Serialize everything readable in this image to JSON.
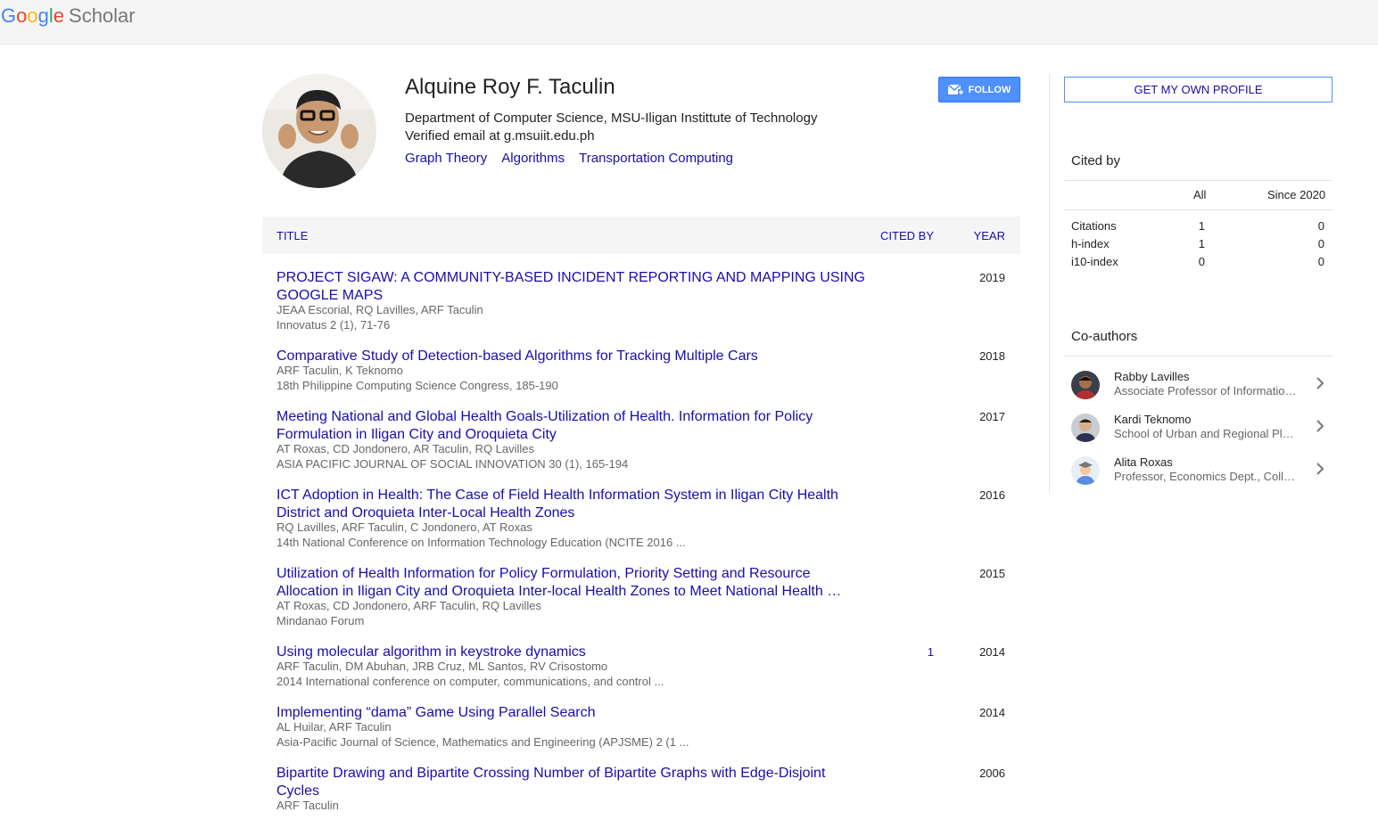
{
  "header": {
    "logo_g1": "G",
    "logo_o1": "o",
    "logo_o2": "o",
    "logo_g2": "g",
    "logo_l": "l",
    "logo_e": "e",
    "logo_scholar": "Scholar"
  },
  "profile": {
    "name": "Alquine Roy F. Taculin",
    "affiliation": "Department of Computer Science, MSU-Iligan Instittute of Technology",
    "email": "Verified email at g.msuiit.edu.ph",
    "interests": [
      "Graph Theory",
      "Algorithms",
      "Transportation Computing"
    ],
    "follow_label": "FOLLOW"
  },
  "table": {
    "col_title": "TITLE",
    "col_cited": "CITED BY",
    "col_year": "YEAR",
    "articles": [
      {
        "title": "PROJECT SIGAW: A COMMUNITY-BASED INCIDENT REPORTING AND MAPPING USING GOOGLE MAPS",
        "authors": "JEAA Escorial, RQ Lavilles, ARF Taculin",
        "venue": "Innovatus 2 (1), 71-76",
        "cited": "",
        "year": "2019"
      },
      {
        "title": "Comparative Study of Detection-based Algorithms for Tracking Multiple Cars",
        "authors": "ARF Taculin, K Teknomo",
        "venue": "18th Philippine Computing Science Congress, 185-190",
        "cited": "",
        "year": "2018"
      },
      {
        "title": "Meeting National and Global Health Goals-Utilization of Health. Information for Policy Formulation in Iligan City and Oroquieta City",
        "authors": "AT Roxas, CD Jondonero, AR Taculin, RQ Lavilles",
        "venue": "ASIA PACIFIC JOURNAL OF SOCIAL INNOVATION 30 (1), 165-194",
        "cited": "",
        "year": "2017"
      },
      {
        "title": "ICT Adoption in Health: The Case of Field Health Information System in Iligan City Health District and Oroquieta Inter-Local Health Zones",
        "authors": "RQ Lavilles, ARF Taculin, C Jondonero, AT Roxas",
        "venue": "14th National Conference on Information Technology Education (NCITE 2016 ...",
        "cited": "",
        "year": "2016"
      },
      {
        "title": "Utilization of Health Information for Policy Formulation, Priority Setting and Resource Allocation in Iligan City and Oroquieta Inter-local Health Zones to Meet National Health …",
        "authors": "AT Roxas, CD Jondonero, ARF Taculin, RQ Lavilles",
        "venue": "Mindanao Forum",
        "cited": "",
        "year": "2015"
      },
      {
        "title": "Using molecular algorithm in keystroke dynamics",
        "authors": "ARF Taculin, DM Abuhan, JRB Cruz, ML Santos, RV Crisostomo",
        "venue": "2014 International conference on computer, communications, and control ...",
        "cited": "1",
        "year": "2014"
      },
      {
        "title": "Implementing “dama” Game Using Parallel Search",
        "authors": "AL Huilar, ARF Taculin",
        "venue": "Asia-Pacific Journal of Science, Mathematics and Engineering (APJSME) 2 (1 ...",
        "cited": "",
        "year": "2014"
      },
      {
        "title": "Bipartite Drawing and Bipartite Crossing Number of Bipartite Graphs with Edge-Disjoint Cycles",
        "authors": "ARF Taculin",
        "venue": "",
        "cited": "",
        "year": "2006"
      }
    ]
  },
  "sidebar": {
    "own_profile_label": "GET MY OWN PROFILE",
    "cited_by_title": "Cited by",
    "col_all": "All",
    "col_since": "Since 2020",
    "metrics": [
      {
        "label": "Citations",
        "all": "1",
        "since": "0"
      },
      {
        "label": "h-index",
        "all": "1",
        "since": "0"
      },
      {
        "label": "i10-index",
        "all": "0",
        "since": "0"
      }
    ],
    "coauthors_title": "Co-authors",
    "coauthors": [
      {
        "name": "Rabby Lavilles",
        "affiliation": "Associate Professor of Information Technology"
      },
      {
        "name": "Kardi Teknomo",
        "affiliation": "School of Urban and Regional Planning"
      },
      {
        "name": "Alita Roxas",
        "affiliation": "Professor, Economics Dept., College of Business"
      }
    ]
  },
  "colors": {
    "link": "#1a0dab",
    "button_blue": "#4d90fe",
    "header_bg": "#f5f5f5"
  },
  "icons": [
    "mail-plus-icon",
    "chevron-right-icon"
  ]
}
